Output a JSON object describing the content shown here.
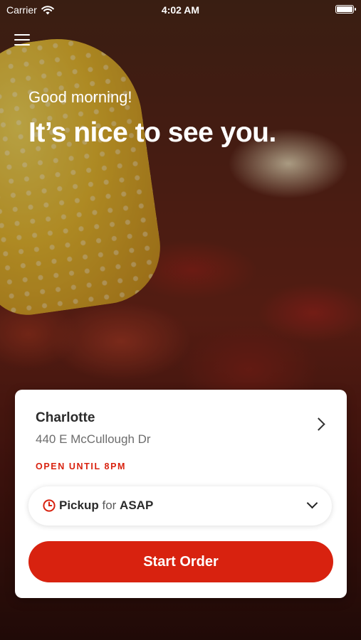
{
  "status_bar": {
    "carrier": "Carrier",
    "time": "4:02 AM",
    "wifi_icon": "wifi-icon",
    "battery_icon": "battery-icon"
  },
  "menu": {
    "icon": "hamburger-menu-icon"
  },
  "hero": {
    "greeting": "Good morning!",
    "headline": "It’s nice to see you."
  },
  "store": {
    "name": "Charlotte",
    "address": "440 E McCullough Dr",
    "hours": "OPEN UNTIL 8PM",
    "icon": "chevron-right-icon"
  },
  "order_mode": {
    "icon": "clock-icon",
    "mode": "Pickup",
    "connector": " for ",
    "timing": "ASAP",
    "dropdown_icon": "chevron-down-icon"
  },
  "cta": {
    "label": "Start Order"
  },
  "colors": {
    "accent": "#d8220f",
    "text_primary": "#2b2b2b",
    "text_secondary": "#6d6d6d"
  }
}
